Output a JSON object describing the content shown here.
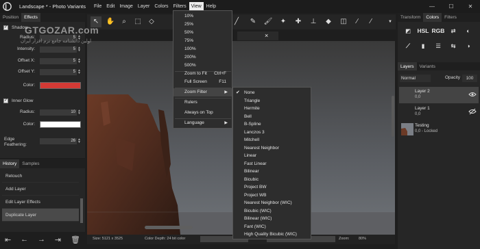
{
  "window": {
    "title": "Landscape * - Photo Variants"
  },
  "menubar": [
    "File",
    "Edit",
    "Image",
    "Layer",
    "Colors",
    "Filters",
    "View",
    "Help"
  ],
  "left_panel": {
    "tabs": [
      "Position",
      "Effects"
    ],
    "drop_shadow": {
      "label": "Shadow",
      "radius_label": "Radius:",
      "radius": "5",
      "intensity_label": "Intensity:",
      "intensity": "5",
      "offset_x_label": "Offset X:",
      "offset_x": "5",
      "offset_y_label": "Offset Y:",
      "offset_y": "5",
      "color_label": "Color:",
      "color": "#d33a35"
    },
    "inner_glow": {
      "label": "Inner Glow",
      "radius_label": "Radius:",
      "radius": "10",
      "color_label": "Color:",
      "color": "#ffffff"
    },
    "edge_feathering_label": "Edge\nFeathering:",
    "edge_feathering": "26"
  },
  "history": {
    "tabs": [
      "History",
      "Samples"
    ],
    "items": [
      "Retouch",
      "Add Layer",
      "Edit Layer Effects",
      "Duplicate Layer"
    ],
    "selected_index": 3
  },
  "view_menu": {
    "items": [
      "10%",
      "25%",
      "50%",
      "75%",
      "100%",
      "200%",
      "500%",
      "Zoom to Fit",
      "Full Screen",
      "Zoom Filter",
      "Rulers",
      "Always on Top",
      "Language"
    ],
    "shortcuts": {
      "zoom_to_fit": "Ctrl+F",
      "full_screen": "F11"
    },
    "highlighted": "Zoom Filter"
  },
  "zoom_filter_menu": {
    "items": [
      "None",
      "Triangle",
      "Hermite",
      "Bell",
      "B-Spline",
      "Lanczos 3",
      "Mitchell",
      "Nearest Neighbor",
      "Linear",
      "Fast Linear",
      "Bilinear",
      "Bicubic",
      "Project BW",
      "Project WB",
      "Nearest Neighbor (WIC)",
      "Bicubic (WIC)",
      "Bilinear (WIC)",
      "Fant (WIC)",
      "High Quality Bicubic (WIC)"
    ],
    "checked": "None"
  },
  "document": {
    "tab_close": "×"
  },
  "status": {
    "size": "Size: 5121 x 3525",
    "color_depth": "Color Depth: 24 bit color",
    "zoom_label": "Zoom:",
    "zoom_value": "80%"
  },
  "right_panel": {
    "tabs": [
      "Transform",
      "Colors",
      "Filters"
    ],
    "adjust_labels": {
      "hsl": "HSL",
      "rgb": "RGB"
    },
    "layer_tabs": [
      "Layers",
      "Variants"
    ],
    "blend_mode": "Normal",
    "opacity_label": "Opacity",
    "opacity_value": "100",
    "layers": [
      {
        "name": "Layer 2",
        "sub": "0,0"
      },
      {
        "name": "Layer 1",
        "sub": "0,0"
      },
      {
        "name": "Testing",
        "sub": "0,0 - Locked"
      }
    ]
  },
  "watermark": {
    "main": "GTGOZAR.com",
    "sub": "اولین دانشنامه جامع نرم افزار ایران"
  },
  "colors": {
    "accent_red": "#d33a35",
    "panel_bg": "#262626",
    "menu_bg": "#2d2d2d"
  }
}
